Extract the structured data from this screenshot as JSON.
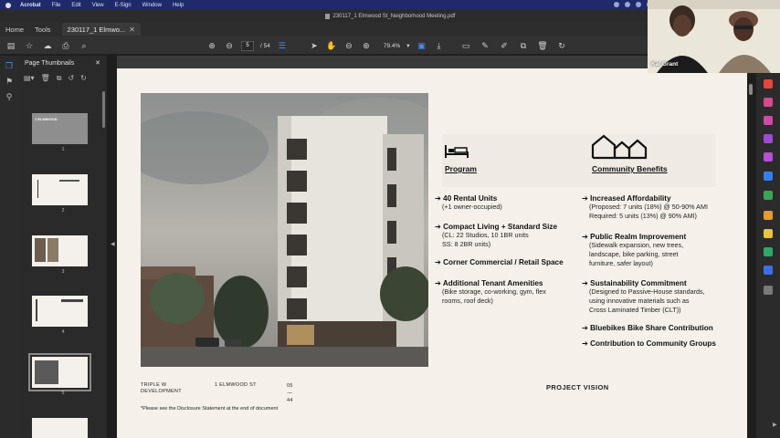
{
  "menubar": {
    "app": "Acrobat",
    "items": [
      "File",
      "Edit",
      "View",
      "E-Sign",
      "Window",
      "Help"
    ]
  },
  "window": {
    "title": "230117_1 Elmwood St_Neighborhood Meeting.pdf"
  },
  "tabs": {
    "home": "Home",
    "tools": "Tools",
    "doc_tab": "230117_1 Elmwo..."
  },
  "toolbar": {
    "current_page": "5",
    "page_total": "/ 54",
    "zoom": "79.4%"
  },
  "panel": {
    "title": "Page Thumbnails",
    "thumbs": [
      {
        "num": "1",
        "caption": "1 ELMWOOD"
      },
      {
        "num": "2"
      },
      {
        "num": "3"
      },
      {
        "num": "4"
      },
      {
        "num": "5"
      }
    ]
  },
  "video": {
    "participant": "Kai Grant"
  },
  "slide": {
    "program": {
      "title": "Program",
      "items": [
        {
          "head": "➔ 40 Rental Units",
          "sub": [
            "(+1 owner-occupied)"
          ]
        },
        {
          "head": "➔ Compact Living + Standard Size",
          "sub": [
            "(CL:  22 Studios, 10 1BR units",
            " SS:  8 2BR units)"
          ]
        },
        {
          "head": "➔ Corner Commercial / Retail Space",
          "sub": []
        },
        {
          "head": "➔ Additional Tenant Amenities",
          "sub": [
            "(Bike storage, co-working, gym, flex",
            "rooms, roof deck)"
          ]
        }
      ]
    },
    "community": {
      "title": "Community Benefits",
      "items": [
        {
          "head": "➔ Increased Affordability",
          "sub": [
            "(Proposed: 7 units (18%) @ 50-90% AMI",
            " Required: 5 units (13%) @ 90% AMI)"
          ]
        },
        {
          "head": "➔ Public Realm Improvement",
          "sub": [
            "(Sidewalk expansion, new trees,",
            "landscape, bike parking, street",
            "furniture, safer layout)"
          ]
        },
        {
          "head": "➔ Sustainability Commitment",
          "sub": [
            "(Designed to Passive-House standards,",
            "using innovative materials such as",
            "Cross Laminated Timber (CLT))"
          ]
        },
        {
          "head": "➔ Bluebikes Bike Share Contribution",
          "sub": []
        },
        {
          "head": "➔ Contribution to Community Groups",
          "sub": []
        }
      ]
    },
    "footer": {
      "developer_line1": "TRIPLE W",
      "developer_line2": "DEVELOPMENT",
      "address": "1 ELMWOOD ST",
      "page": "05",
      "dash": "—",
      "total": "44",
      "vision": "PROJECT VISION",
      "disclosure": "*Please see the Disclosure Statement at the end of document"
    }
  },
  "colors": {
    "accent": "#4a8ff0",
    "menubar": "#1f2a6b",
    "slide_bg": "#f5f1ea"
  }
}
